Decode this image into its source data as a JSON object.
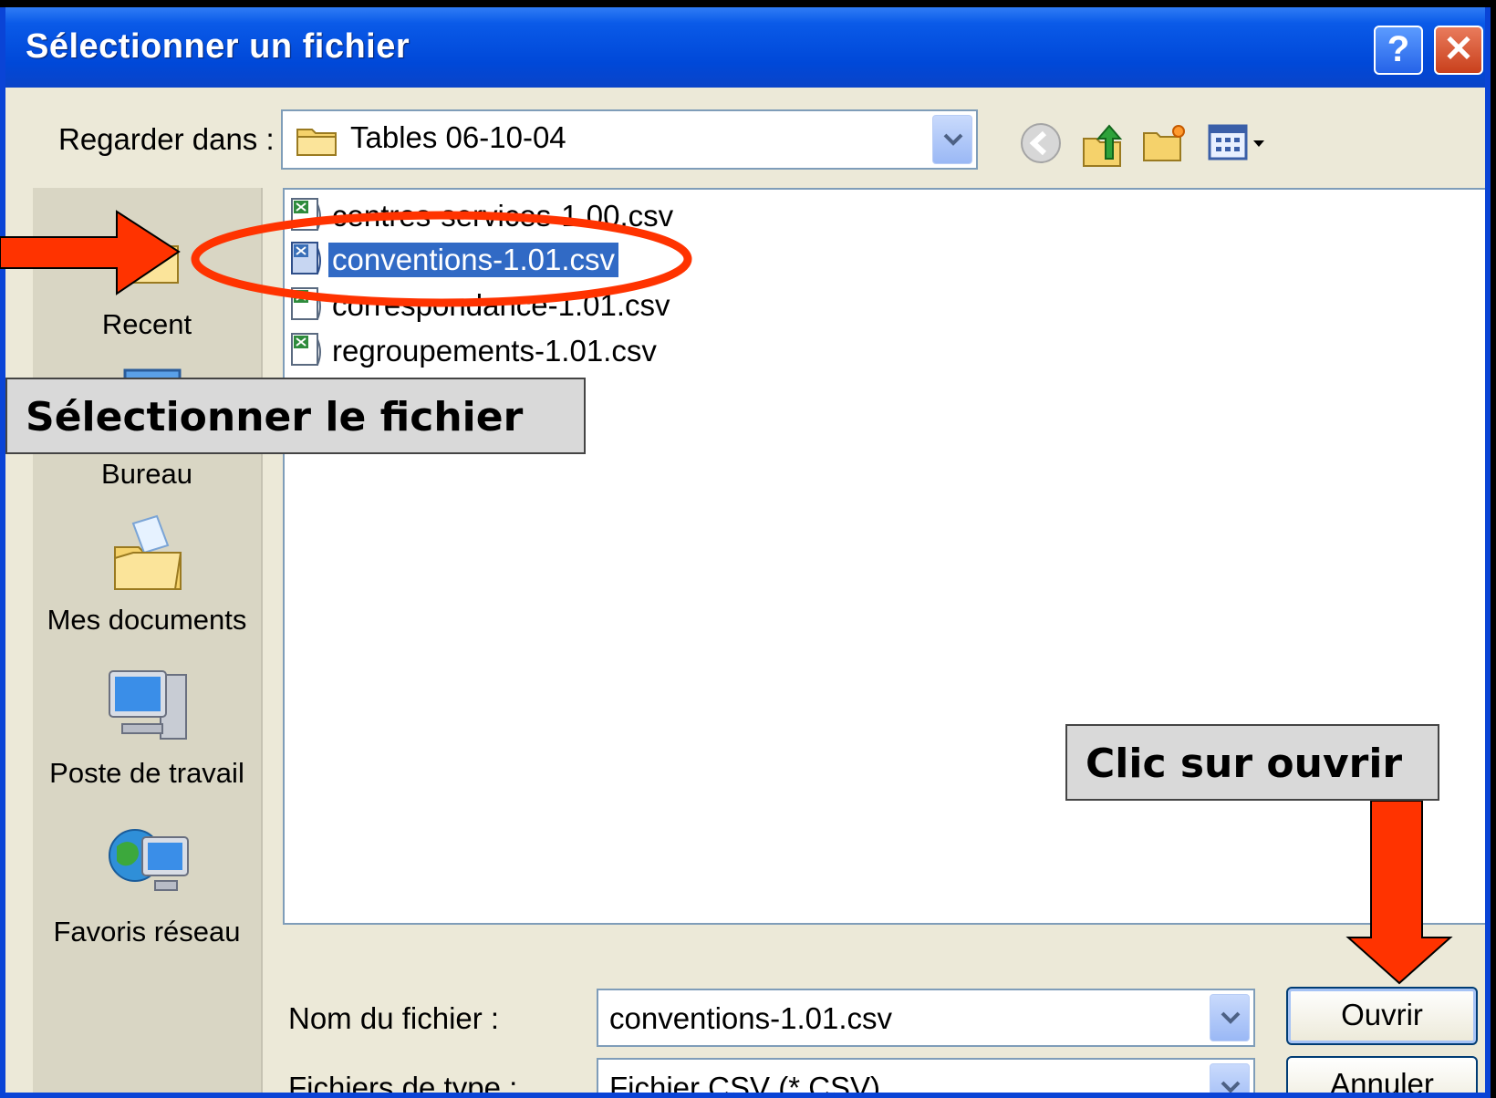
{
  "dialog": {
    "title": "Sélectionner un fichier",
    "help_label": "?",
    "close_label": "✕"
  },
  "look_in": {
    "label": "Regarder dans :",
    "value": "Tables 06-10-04"
  },
  "places": [
    {
      "label": "Recent",
      "icon": "recent-folder-icon"
    },
    {
      "label": "Bureau",
      "icon": "desktop-icon"
    },
    {
      "label": "Mes documents",
      "icon": "my-documents-icon"
    },
    {
      "label": "Poste de travail",
      "icon": "my-computer-icon"
    },
    {
      "label": "Favoris réseau",
      "icon": "network-places-icon"
    }
  ],
  "files": [
    {
      "name": "centres-services-1.00.csv",
      "selected": false
    },
    {
      "name": "conventions-1.01.csv",
      "selected": true
    },
    {
      "name": "correspondance-1.01.csv",
      "selected": false
    },
    {
      "name": "regroupements-1.01.csv",
      "selected": false
    }
  ],
  "filename": {
    "label": "Nom du fichier :",
    "value": "conventions-1.01.csv"
  },
  "filetype": {
    "label": "Fichiers de type :",
    "value": "Fichier CSV (*.CSV)"
  },
  "buttons": {
    "open": "Ouvrir",
    "cancel": "Annuler"
  },
  "annotations": {
    "select_file": "Sélectionner le fichier",
    "click_open": "Clic sur ouvrir",
    "arrow_color": "#ff3300",
    "highlight_color": "#ff3300"
  },
  "colors": {
    "titlebar": "#0048d8",
    "selection": "#316ac5",
    "dialog_bg": "#ece9d8"
  }
}
